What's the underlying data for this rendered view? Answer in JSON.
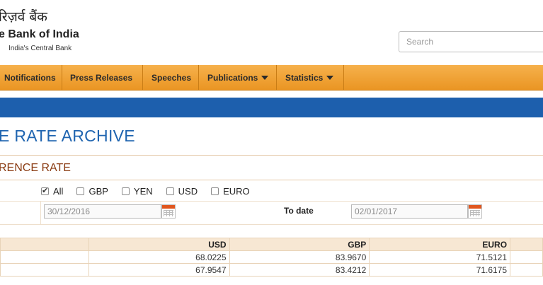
{
  "header": {
    "hindi_name": "रिज़र्व बैंक",
    "bank_name": "e Bank of India",
    "tagline": "India's Central Bank",
    "search_placeholder": "Search"
  },
  "nav": {
    "items": [
      {
        "label": "Notifications"
      },
      {
        "label": "Press Releases"
      },
      {
        "label": "Speeches"
      },
      {
        "label": "Publications"
      },
      {
        "label": "Statistics"
      }
    ]
  },
  "page": {
    "title": "E RATE ARCHIVE",
    "section_title": "RENCE RATE"
  },
  "filters": {
    "currencies": [
      {
        "label": "All",
        "checked": true
      },
      {
        "label": "GBP",
        "checked": false
      },
      {
        "label": "YEN",
        "checked": false
      },
      {
        "label": "USD",
        "checked": false
      },
      {
        "label": "EURO",
        "checked": false
      }
    ],
    "from_date": "30/12/2016",
    "to_label": "To date",
    "to_date": "02/01/2017"
  },
  "table": {
    "headers": [
      "",
      "USD",
      "GBP",
      "EURO"
    ],
    "rows": [
      [
        "",
        "68.0225",
        "83.9670",
        "71.5121"
      ],
      [
        "",
        "67.9547",
        "83.4212",
        "71.6175"
      ]
    ]
  },
  "colors": {
    "nav_bg": "#ea9523",
    "blue_band": "#1d5fad",
    "title": "#2065b0",
    "section": "#8a3b12"
  }
}
